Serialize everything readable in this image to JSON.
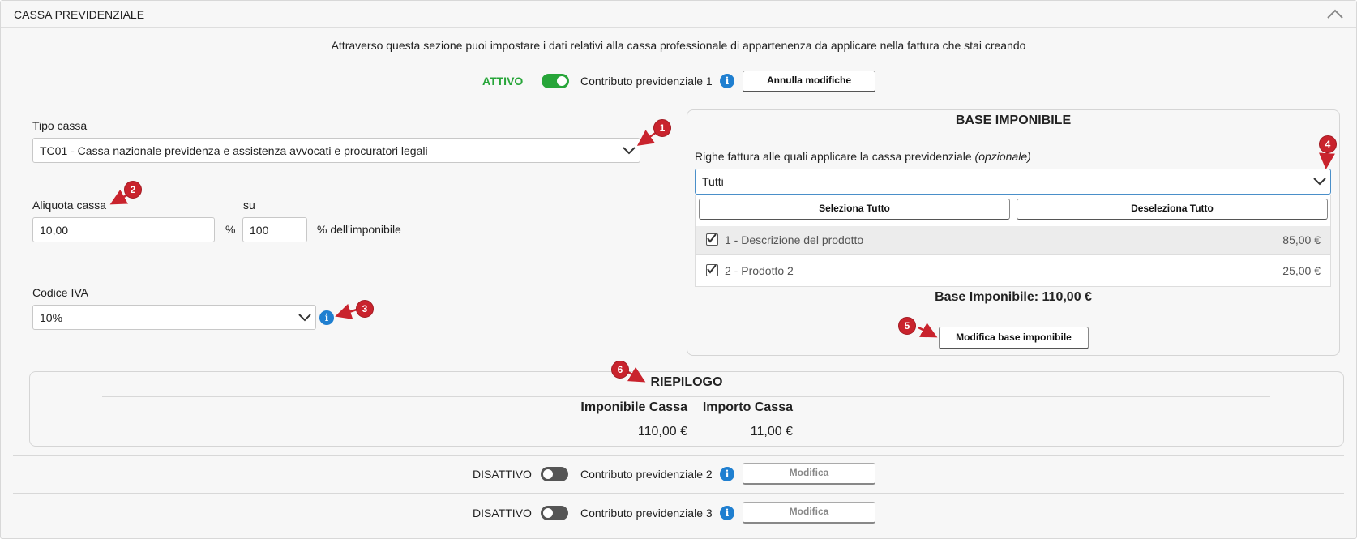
{
  "section": {
    "title": "CASSA PREVIDENZIALE"
  },
  "intro": "Attraverso questa sezione puoi impostare i dati relativi alla cassa professionale di appartenenza da applicare nella fattura che stai creando",
  "contrib1": {
    "status": "ATTIVO",
    "label": "Contributo previdenziale 1",
    "button": "Annulla modifiche"
  },
  "tipo_cassa": {
    "label": "Tipo cassa",
    "value": "TC01 - Cassa nazionale previdenza e assistenza avvocati e procuratori legali"
  },
  "aliquota": {
    "label": "Aliquota cassa",
    "value": "10,00",
    "percent_sign": "%",
    "su_label": "su",
    "su_value": "100",
    "suffix": "% dell'imponibile"
  },
  "codice_iva": {
    "label": "Codice IVA",
    "value": "10%"
  },
  "base": {
    "title": "BASE IMPONIBILE",
    "righe_label": "Righe fattura alle quali applicare la cassa previdenziale",
    "righe_optional": "(opzionale)",
    "select_value": "Tutti",
    "select_all": "Seleziona Tutto",
    "deselect_all": "Deseleziona Tutto",
    "items": [
      {
        "label": "1 - Descrizione del prodotto",
        "amount": "85,00 €"
      },
      {
        "label": "2 - Prodotto 2",
        "amount": "25,00 €"
      }
    ],
    "total": "Base Imponibile: 110,00 €",
    "modify_button": "Modifica base imponibile"
  },
  "riepilogo": {
    "title": "RIEPILOGO",
    "col1": "Imponibile Cassa",
    "col2": "Importo Cassa",
    "val1": "110,00 €",
    "val2": "11,00 €"
  },
  "contrib2": {
    "status": "DISATTIVO",
    "label": "Contributo previdenziale 2",
    "button": "Modifica"
  },
  "contrib3": {
    "status": "DISATTIVO",
    "label": "Contributo previdenziale 3",
    "button": "Modifica"
  },
  "badges": [
    "1",
    "2",
    "3",
    "4",
    "5",
    "6"
  ],
  "colors": {
    "active_green": "#27a539",
    "info_blue": "#1f7fd0",
    "badge_red": "#c9232d"
  }
}
